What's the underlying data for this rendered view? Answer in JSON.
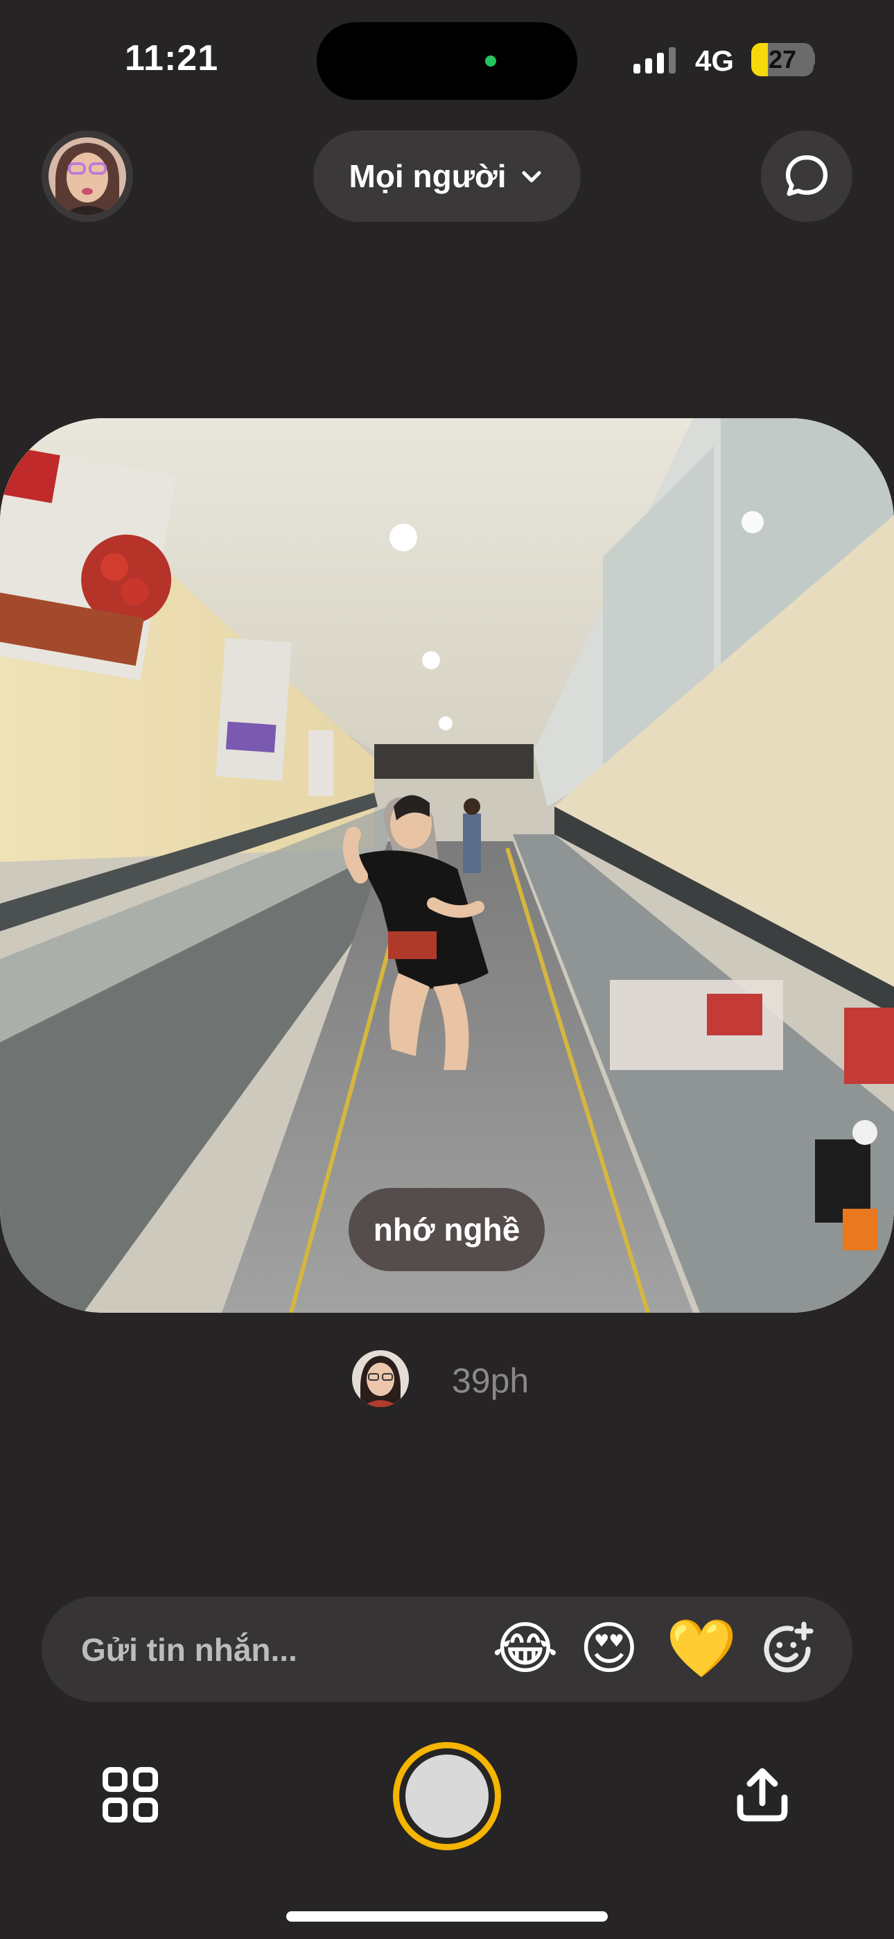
{
  "status_bar": {
    "time": "11:21",
    "network": "4G",
    "battery": "27",
    "battery_level": 0.27,
    "signal_bars": 3,
    "privacy_indicator_color": "#22c55e"
  },
  "header": {
    "audience_label": "Mọi người",
    "audience_icon": "chevron-down-icon",
    "chat_icon": "chat-bubble-icon"
  },
  "post": {
    "caption": "nhớ nghề",
    "sender_time": "39ph"
  },
  "composer": {
    "placeholder": "Gửi tin nhắn...",
    "reactions": [
      "😂",
      "😍",
      "💛"
    ],
    "add_reaction_icon": "add-emoji-icon"
  },
  "bottom_bar": {
    "grid_icon": "grid-icon",
    "shutter_color": "#f5b500",
    "share_icon": "share-icon"
  }
}
